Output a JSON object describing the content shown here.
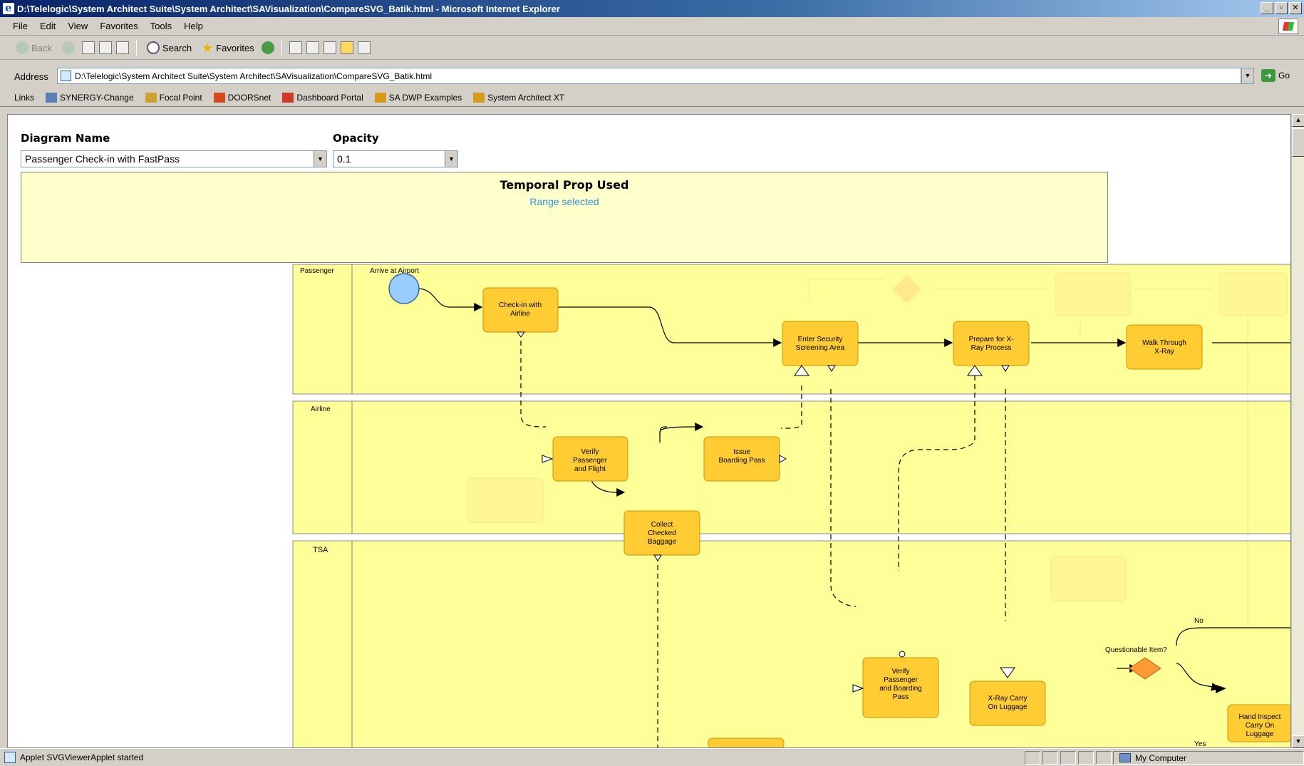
{
  "window": {
    "title": "D:\\Telelogic\\System Architect Suite\\System Architect\\SAVisualization\\CompareSVG_Batik.html - Microsoft Internet Explorer",
    "controls": [
      "_",
      "▫",
      "✕"
    ]
  },
  "menu": [
    "File",
    "Edit",
    "View",
    "Favorites",
    "Tools",
    "Help"
  ],
  "toolbar": {
    "back": "Back",
    "search": "Search",
    "favorites": "Favorites"
  },
  "address": {
    "label": "Address",
    "url": "D:\\Telelogic\\System Architect Suite\\System Architect\\SAVisualization\\CompareSVG_Batik.html",
    "go": "Go"
  },
  "links": {
    "label": "Links",
    "items": [
      {
        "label": "SYNERGY-Change",
        "icon": "synergy-icon",
        "color": "#5a7fb5"
      },
      {
        "label": "Focal Point",
        "icon": "focal-point-icon",
        "color": "#d0a030"
      },
      {
        "label": "DOORSnet",
        "icon": "doors-icon",
        "color": "#d24a1e"
      },
      {
        "label": "Dashboard Portal",
        "icon": "dashboard-icon",
        "color": "#cc3a2a"
      },
      {
        "label": "SA DWP Examples",
        "icon": "sa-icon",
        "color": "#d89a1a"
      },
      {
        "label": "System Architect XT",
        "icon": "sa-xt-icon",
        "color": "#d89a1a"
      }
    ]
  },
  "form": {
    "diagram_label": "Diagram Name",
    "diagram_value": "Passenger Check-in with FastPass",
    "opacity_label": "Opacity",
    "opacity_value": "0.1"
  },
  "info": {
    "title": "Temporal Prop Used",
    "subtitle": "Range selected"
  },
  "diagram": {
    "lanes": [
      {
        "name": "Passenger"
      },
      {
        "name": "Airline"
      },
      {
        "name": "TSA"
      }
    ],
    "start_event": "Arrive at Airport",
    "tasks": {
      "checkin": [
        "Check-in with",
        "Airline"
      ],
      "enter_security": [
        "Enter Security",
        "Screening Area"
      ],
      "prepare_xray": [
        "Prepare for X-",
        "Ray Process"
      ],
      "walk_xray": [
        "Walk Through",
        "X-Ray"
      ],
      "verify_flight": [
        "Verify",
        "Passenger",
        "and Flight"
      ],
      "issue_pass": [
        "Issue",
        "Boarding Pass"
      ],
      "collect_baggage": [
        "Collect",
        "Checked",
        "Baggage"
      ],
      "verify_pass": [
        "Verify",
        "Passenger",
        "and Boarding",
        "Pass"
      ],
      "xray_carry": [
        "X-Ray Carry",
        "On Luggage"
      ],
      "hand_inspect": [
        "Hand Inspect",
        "Carry On",
        "Luggage"
      ]
    },
    "gateway_label": "Questionable Item?",
    "no_label": "No",
    "yes_label": "Yes",
    "colors": {
      "lane_fill": "#ffff99",
      "task_fill": "#ffcc33",
      "task_stroke": "#c89600",
      "start_fill": "#99ccff",
      "gateway_fill": "#ff9933"
    }
  },
  "status": {
    "text": "Applet SVGViewerApplet started",
    "zone": "My Computer"
  }
}
